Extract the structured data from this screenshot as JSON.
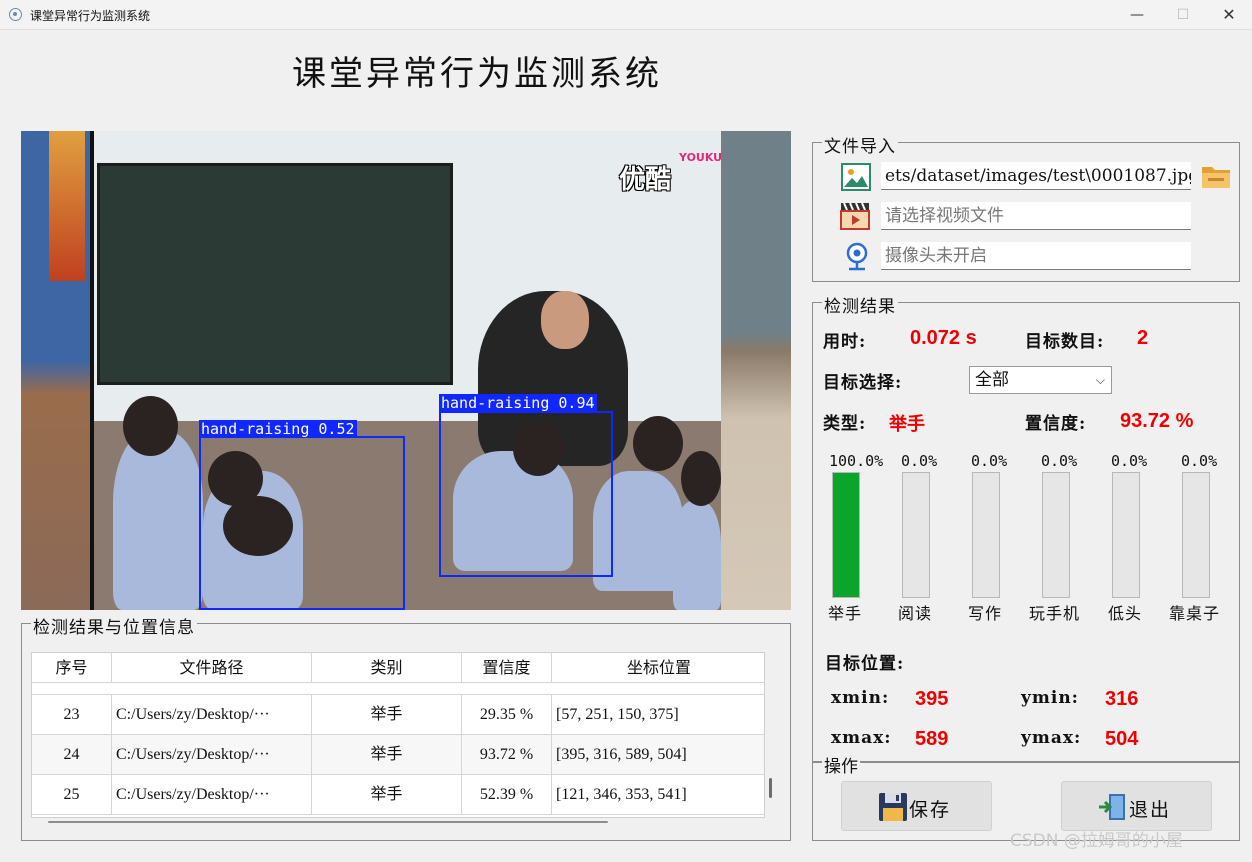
{
  "window": {
    "title": "课堂异常行为监测系统",
    "minimize": "—",
    "maximize": "☐",
    "close": "✕"
  },
  "main_title": "课堂异常行为监测系统",
  "video": {
    "logo": "优酷",
    "logo_sub": "YOUKU",
    "detections": [
      {
        "label": "hand-raising 0.52"
      },
      {
        "label": "hand-raising 0.94"
      }
    ]
  },
  "file_import": {
    "title": "文件导入",
    "image_path": "ets/dataset/images/test\\0001087.jpg",
    "video_placeholder": "请选择视频文件",
    "camera_status": "摄像头未开启"
  },
  "results": {
    "title": "检测结果",
    "time_label": "用时:",
    "time_value": "0.072 s",
    "count_label": "目标数目:",
    "count_value": "2",
    "select_label": "目标选择:",
    "select_value": "全部",
    "type_label": "类型:",
    "type_value": "举手",
    "conf_label": "置信度:",
    "conf_value": "93.72 %",
    "bars": [
      {
        "name": "举手",
        "pct": "100.0%",
        "fraction": 1.0
      },
      {
        "name": "阅读",
        "pct": "0.0%",
        "fraction": 0
      },
      {
        "name": "写作",
        "pct": "0.0%",
        "fraction": 0
      },
      {
        "name": "玩手机",
        "pct": "0.0%",
        "fraction": 0
      },
      {
        "name": "低头",
        "pct": "0.0%",
        "fraction": 0
      },
      {
        "name": "靠桌子",
        "pct": "0.0%",
        "fraction": 0
      }
    ],
    "position_label": "目标位置:",
    "xmin_label": "xmin:",
    "xmin": "395",
    "ymin_label": "ymin:",
    "ymin": "316",
    "xmax_label": "xmax:",
    "xmax": "589",
    "ymax_label": "ymax:",
    "ymax": "504",
    "bar_color": "#0aa52a",
    "value_color": "#e00000"
  },
  "actions": {
    "title": "操作",
    "save": "保存",
    "exit": "退出"
  },
  "table": {
    "title": "检测结果与位置信息",
    "headers": [
      "序号",
      "文件路径",
      "类别",
      "置信度",
      "坐标位置"
    ],
    "rows": [
      [
        "23",
        "C:/Users/zy/Desktop/···",
        "举手",
        "29.35 %",
        "[57, 251, 150, 375]"
      ],
      [
        "24",
        "C:/Users/zy/Desktop/···",
        "举手",
        "93.72 %",
        "[395, 316, 589, 504]"
      ],
      [
        "25",
        "C:/Users/zy/Desktop/···",
        "举手",
        "52.39 %",
        "[121, 346, 353, 541]"
      ]
    ]
  },
  "watermark": "CSDN @拉姆哥的小屋"
}
